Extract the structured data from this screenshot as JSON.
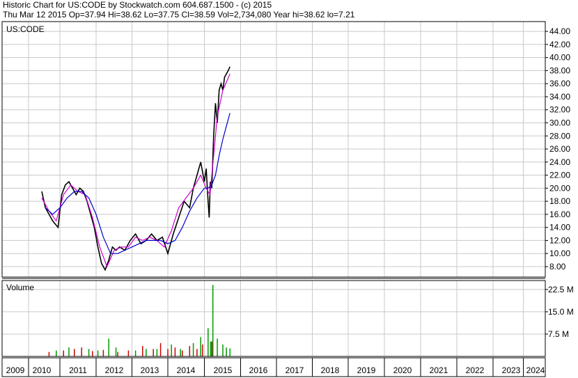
{
  "header": {
    "line1": "Historic Chart for US:CODE by Stockwatch.com 604.687.1500 - (c) 2015",
    "line2": "Thu Mar 12 2015   Op=37.94   Hi=38.62   Lo=37.75   Cl=38.59   Vol=2,734,080   Year hi=38.62   lo=7.21"
  },
  "chart_data": [
    {
      "type": "line",
      "panel": "price",
      "title": "US:CODE",
      "ylim": [
        6.4,
        45.5
      ],
      "yticks": [
        "8.00",
        "10.00",
        "12.00",
        "14.00",
        "16.00",
        "18.00",
        "20.00",
        "22.00",
        "24.00",
        "26.00",
        "28.00",
        "30.00",
        "32.00",
        "34.00",
        "36.00",
        "38.00",
        "40.00",
        "42.00",
        "44.00"
      ],
      "grid": true,
      "series": [
        {
          "color": "#000000",
          "x": [
            2010.0,
            2010.1,
            2010.2,
            2010.3,
            2010.45,
            2010.55,
            2010.65,
            2010.75,
            2010.85,
            2010.95,
            2011.05,
            2011.15,
            2011.25,
            2011.35,
            2011.45,
            2011.55,
            2011.65,
            2011.75,
            2011.85,
            2011.95,
            2012.05,
            2012.15,
            2012.3,
            2012.45,
            2012.6,
            2012.75,
            2012.9,
            2013.05,
            2013.2,
            2013.35,
            2013.5,
            2013.65,
            2013.8,
            2013.95,
            2014.1,
            2014.2,
            2014.3,
            2014.4,
            2014.5,
            2014.55,
            2014.6,
            2014.63,
            2014.66,
            2014.7,
            2014.75,
            2014.8,
            2014.85,
            2014.9,
            2014.95,
            2015.0,
            2015.05,
            2015.1,
            2015.15,
            2015.2
          ],
          "values": [
            19.5,
            17.0,
            16.0,
            15.0,
            14.0,
            19.0,
            20.5,
            21.0,
            20.0,
            19.0,
            20.0,
            19.5,
            18.0,
            16.0,
            14.0,
            11.0,
            8.5,
            7.5,
            9.0,
            11.0,
            10.5,
            11.0,
            10.5,
            12.0,
            13.0,
            11.5,
            12.0,
            13.0,
            12.0,
            12.5,
            10.0,
            13.0,
            15.5,
            18.0,
            17.0,
            20.0,
            22.0,
            24.0,
            21.0,
            23.0,
            18.0,
            15.5,
            21.0,
            20.0,
            28.0,
            33.0,
            30.0,
            35.0,
            36.0,
            35.0,
            37.0,
            37.5,
            38.0,
            38.6
          ]
        },
        {
          "color": "#cc00cc",
          "x": [
            2010.0,
            2010.2,
            2010.4,
            2010.6,
            2010.8,
            2011.0,
            2011.2,
            2011.4,
            2011.6,
            2011.8,
            2012.0,
            2012.2,
            2012.4,
            2012.6,
            2012.8,
            2013.0,
            2013.2,
            2013.4,
            2013.6,
            2013.8,
            2014.0,
            2014.2,
            2014.4,
            2014.55,
            2014.65,
            2014.75,
            2014.85,
            2015.0,
            2015.2
          ],
          "values": [
            18.5,
            16.5,
            15.0,
            19.0,
            20.5,
            19.5,
            19.0,
            15.5,
            11.0,
            8.0,
            10.5,
            11.0,
            11.0,
            12.5,
            12.0,
            12.5,
            12.0,
            11.0,
            13.5,
            17.0,
            18.5,
            20.0,
            22.0,
            20.0,
            19.0,
            25.0,
            31.0,
            35.0,
            37.5
          ]
        },
        {
          "color": "#0000cc",
          "x": [
            2010.1,
            2010.3,
            2010.5,
            2010.7,
            2010.9,
            2011.1,
            2011.3,
            2011.5,
            2011.7,
            2011.9,
            2012.1,
            2012.3,
            2012.5,
            2012.7,
            2012.9,
            2013.1,
            2013.3,
            2013.5,
            2013.7,
            2013.9,
            2014.1,
            2014.3,
            2014.5,
            2014.6,
            2014.7,
            2014.8,
            2014.9,
            2015.0,
            2015.1,
            2015.2
          ],
          "values": [
            17.0,
            16.0,
            17.0,
            18.5,
            19.5,
            19.5,
            18.5,
            16.0,
            12.5,
            10.0,
            10.0,
            10.5,
            11.0,
            11.5,
            12.0,
            12.0,
            12.0,
            11.5,
            12.0,
            14.0,
            16.5,
            18.5,
            20.0,
            20.0,
            20.5,
            22.0,
            25.0,
            27.5,
            29.5,
            31.5
          ]
        }
      ]
    },
    {
      "type": "bar",
      "panel": "volume",
      "title": "Volume",
      "ylim": [
        0,
        25.5
      ],
      "yticks": [
        "7.5 M",
        "15.0 M",
        "22.5 M"
      ],
      "series": [
        {
          "color": "#cc0000",
          "x": [
            2010.2,
            2010.6,
            2010.9,
            2011.1,
            2011.4,
            2011.7,
            2012.1,
            2012.4,
            2012.8,
            2013.1,
            2013.3,
            2013.5,
            2013.7,
            2013.9,
            2014.1,
            2014.3,
            2014.45,
            2014.7
          ],
          "values": [
            1.5,
            2.0,
            2.5,
            3.0,
            1.8,
            2.2,
            1.5,
            2.0,
            3.5,
            2.5,
            4.5,
            2.5,
            3.0,
            2.0,
            3.5,
            2.5,
            4.0,
            5.0
          ]
        },
        {
          "color": "#009900",
          "x": [
            2010.4,
            2010.75,
            2011.3,
            2011.55,
            2011.85,
            2012.05,
            2012.6,
            2012.9,
            2013.2,
            2013.6,
            2013.85,
            2014.2,
            2014.4,
            2014.6,
            2014.67,
            2014.73,
            2014.85,
            2015.0,
            2015.1,
            2015.2
          ],
          "values": [
            2.0,
            3.0,
            2.5,
            2.0,
            6.0,
            3.0,
            2.0,
            2.5,
            2.5,
            4.0,
            2.5,
            4.5,
            6.5,
            9.5,
            5.0,
            24.0,
            6.0,
            4.0,
            3.0,
            2.7
          ]
        }
      ]
    }
  ],
  "x_axis": {
    "labels": [
      "2009",
      "2010",
      "2011",
      "2012",
      "2013",
      "2014",
      "2015",
      "2016",
      "2017",
      "2018",
      "2019",
      "2020",
      "2021",
      "2022",
      "2023",
      "2024"
    ]
  }
}
